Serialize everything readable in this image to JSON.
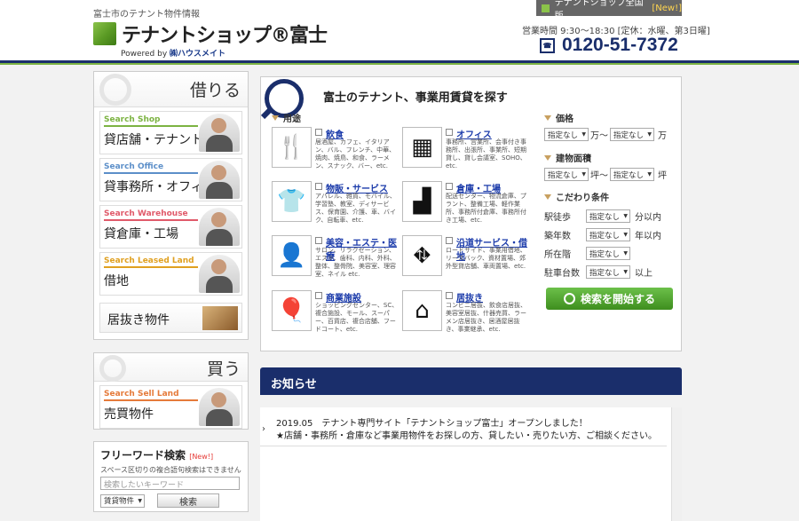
{
  "header": {
    "tagline": "富士市のテナント物件情報",
    "logo_text": "テナントショップ®富士",
    "powered_by": "Powered by",
    "powered_brand": "㈱ハウスメイト",
    "national_label": "テナントショップ全国版",
    "national_new": "[New!]",
    "hours": "営業時間 9:30～18:30 [定休：水曜、第3日曜]",
    "phone": "0120-51-7372"
  },
  "rent_box": {
    "title": "借りる",
    "items": [
      {
        "en": "Search Shop",
        "ja": "貸店舗・テナント",
        "color": "#7cb342"
      },
      {
        "en": "Search Office",
        "ja": "貸事務所・オフィス",
        "color": "#5c8fc9"
      },
      {
        "en": "Search Warehouse",
        "ja": "貸倉庫・工場",
        "color": "#e05a6a"
      },
      {
        "en": "Search Leased Land",
        "ja": "借地",
        "color": "#e0a020"
      }
    ],
    "inoki": "居抜き物件"
  },
  "buy_box": {
    "title": "買う",
    "item": {
      "en": "Search Sell Land",
      "ja": "売買物件",
      "color": "#e57a3a"
    }
  },
  "freeword": {
    "title": "フリーワード検索",
    "new": "[New!]",
    "note": "スペース区切りの複合語句検索はできません",
    "placeholder": "検索したいキーワード",
    "select": "賃貸物件",
    "button": "検索"
  },
  "search": {
    "title": "富士のテナント、事業用賃貸を探す",
    "use_label": "用途",
    "uses": [
      {
        "icon": "fork-knife-icon",
        "glyph": "🍴",
        "name": "飲食",
        "desc": "居酒屋、カフェ、イタリアン、バル、フレンチ、中華、焼肉、焼鳥、和食、ラーメン、スナック、バー、etc."
      },
      {
        "icon": "desk-icon",
        "glyph": "▦",
        "name": "オフィス",
        "desc": "事務所、営業所、会事付き事務所、出張所、事業所、短期貸し、貸し会議室、SOHO、etc."
      },
      {
        "icon": "shirt-icon",
        "glyph": "👕",
        "name": "物販・サービス",
        "desc": "アパレル、雑貨、モバイル、学習塾、教室、ディサービス、保育園、介護、車、バイク、自転車、etc."
      },
      {
        "icon": "factory-icon",
        "glyph": "▟",
        "name": "倉庫・工場",
        "desc": "配送センター、物流倉庫、プラント、整備工場、軽作業所、事務所付倉庫、事務所付き工場、etc."
      },
      {
        "icon": "person-icon",
        "glyph": "👤",
        "name": "美容・エステ・医療",
        "desc": "サロン、リラクゼーション、エステ、歯科、内科、外科、整体、整骨院、美容室、理容室、ネイル etc."
      },
      {
        "icon": "road-icon",
        "glyph": "⛖",
        "name": "沿道サービス・借地",
        "desc": "ロードサイド、事業用借地、リースバック、資材置場、郊外型貸店舗、車両置場、etc."
      },
      {
        "icon": "balloon-icon",
        "glyph": "🎈",
        "name": "商業施設",
        "desc": "ショッピングセンター、SC、複合施設、モール、スーパー、百貨店、複合店舗、フードコート、etc."
      },
      {
        "icon": "shop-house-icon",
        "glyph": "⌂",
        "name": "居抜き",
        "desc": "コンビニ居抜、飲食店居抜、美容室居抜、什器売買、ラーメン店居抜き、居酒屋居抜き、事業継承、etc."
      }
    ],
    "price_label": "価格",
    "price_from": "指定なし",
    "price_to": "指定なし",
    "man_tilde": "万～",
    "man": "万",
    "area_label": "建物面積",
    "area_from": "指定なし",
    "area_to": "指定なし",
    "tsubo_tilde": "坪～",
    "tsubo": "坪",
    "kodawari_label": "こだわり条件",
    "conditions": [
      {
        "label": "駅徒歩",
        "value": "指定なし",
        "unit": "分以内"
      },
      {
        "label": "築年数",
        "value": "指定なし",
        "unit": "年以内"
      },
      {
        "label": "所在階",
        "value": "指定なし",
        "unit": ""
      },
      {
        "label": "駐車台数",
        "value": "指定なし",
        "unit": "以上"
      }
    ],
    "go_button": "検索を開始する"
  },
  "news": {
    "title": "お知らせ",
    "line1": "2019.05　テナント専門サイト「テナントショップ富士」オープンしました！",
    "line2": "★店舗・事務所・倉庫など事業用物件をお探しの方、貸したい・売りたい方、ご相談ください。"
  }
}
